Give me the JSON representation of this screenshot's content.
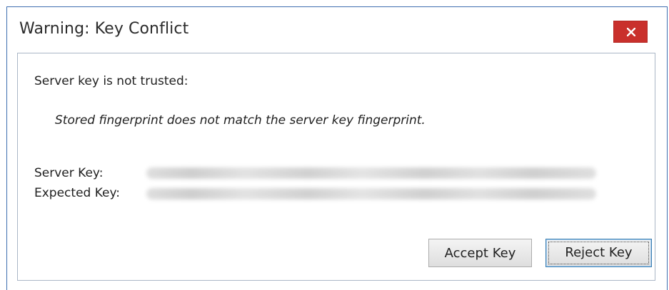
{
  "window": {
    "title": "Warning: Key Conflict",
    "close_icon": "close-icon"
  },
  "content": {
    "heading": "Server key is not trusted:",
    "message": "Stored fingerprint does not match the server key fingerprint.",
    "server_key_label": "Server Key:",
    "expected_key_label": "Expected Key:"
  },
  "buttons": {
    "accept": "Accept Key",
    "reject": "Reject Key"
  },
  "colors": {
    "close_button": "#c9302c",
    "window_border": "#3f6fb0"
  }
}
